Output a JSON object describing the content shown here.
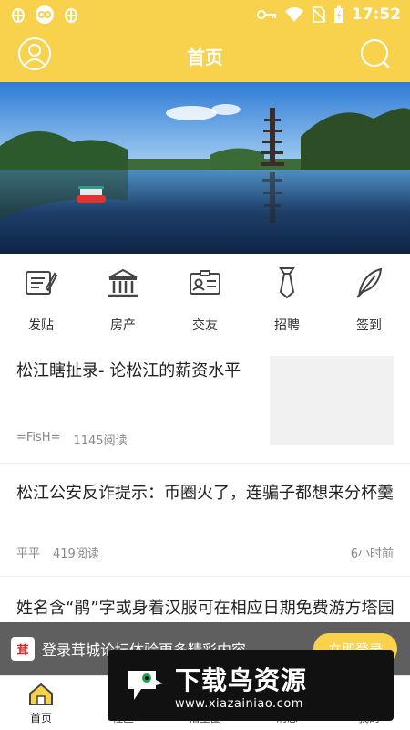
{
  "status_bar": {
    "time": "17:52",
    "left_icons": [
      "bug-icon",
      "infinity-icon",
      "bug-icon"
    ],
    "right_icons": [
      "key-icon",
      "wifi-icon",
      "no-sim-icon",
      "battery-icon"
    ]
  },
  "header": {
    "title": "首页",
    "left_icon": "user-icon",
    "right_icon": "search-icon"
  },
  "banner": {
    "image": "lake-pagoda-photo"
  },
  "quick_nav": [
    {
      "label": "发贴",
      "icon": "post-icon"
    },
    {
      "label": "房产",
      "icon": "building-icon"
    },
    {
      "label": "交友",
      "icon": "id-card-icon"
    },
    {
      "label": "招聘",
      "icon": "tie-icon"
    },
    {
      "label": "签到",
      "icon": "feather-icon"
    }
  ],
  "posts": [
    {
      "title": "松江瞎扯录- 论松江的薪资水平",
      "author": "=FisH=",
      "reads": "1145阅读",
      "time": ""
    },
    {
      "title": "松江公安反诈提示：币圈火了，连骗子都想来分杯羹",
      "author": "平平",
      "reads": "419阅读",
      "time": "6小时前"
    },
    {
      "title": "姓名含“鹃”字或身着汉服可在相应日期免费游方塔园",
      "author": "",
      "reads": "",
      "time": ""
    }
  ],
  "login_prompt": {
    "logo_text": "茸",
    "text": "登录茸城论坛体验更多精彩内容",
    "button": "立即登录"
  },
  "tabs": [
    {
      "label": "首页",
      "icon": "home-icon",
      "active": true
    },
    {
      "label": "社区",
      "icon": "community-icon",
      "active": false
    },
    {
      "label": "招生圈",
      "icon": "circle-icon",
      "active": false
    },
    {
      "label": "消息",
      "icon": "message-icon",
      "active": false
    },
    {
      "label": "我的",
      "icon": "profile-icon",
      "active": false
    }
  ],
  "watermark": {
    "title": "下载鸟资源",
    "url": "www.xiazainiao.com"
  },
  "colors": {
    "accent": "#f8d24c",
    "text": "#222222",
    "meta": "#888888"
  }
}
